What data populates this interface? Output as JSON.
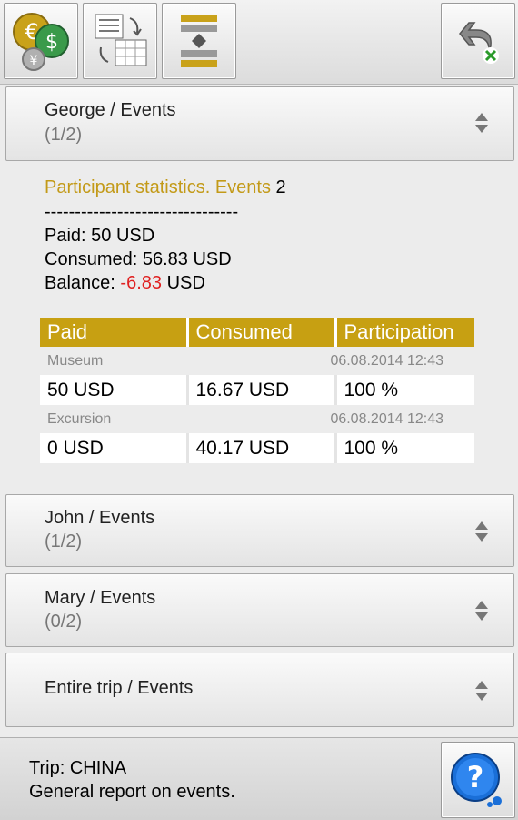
{
  "toolbar": {
    "buttons": [
      {
        "icon": "currency-icon"
      },
      {
        "icon": "report-export-icon"
      },
      {
        "icon": "sort-icon"
      },
      {
        "icon": "undo-delete-icon"
      }
    ]
  },
  "sections": [
    {
      "title": "George / Events",
      "subtitle": "(1/2)"
    },
    {
      "title": "John / Events",
      "subtitle": "(1/2)"
    },
    {
      "title": "Mary / Events",
      "subtitle": "(0/2)"
    },
    {
      "title": "Entire trip / Events",
      "subtitle": ""
    }
  ],
  "stats": {
    "title": "Participant statistics. Events",
    "count": "2",
    "separator": "--------------------------------",
    "paid": "Paid: 50 USD",
    "consumed": "Consumed: 56.83 USD",
    "balance_label": "Balance:",
    "balance_value": "-6.83",
    "balance_unit": "USD"
  },
  "table": {
    "headers": [
      "Paid",
      "Consumed",
      "Participation"
    ],
    "events": [
      {
        "name": "Museum",
        "date": "06.08.2014 12:43",
        "paid": "50 USD",
        "consumed": "16.67 USD",
        "participation": "100 %"
      },
      {
        "name": "Excursion",
        "date": "06.08.2014 12:43",
        "paid": "0 USD",
        "consumed": "40.17 USD",
        "participation": "100 %"
      }
    ]
  },
  "footer": {
    "trip": "Trip: CHINA",
    "description": "General report on events.",
    "help_icon": "help-icon"
  },
  "colors": {
    "accent": "#c7a012",
    "negative": "#e02020"
  }
}
